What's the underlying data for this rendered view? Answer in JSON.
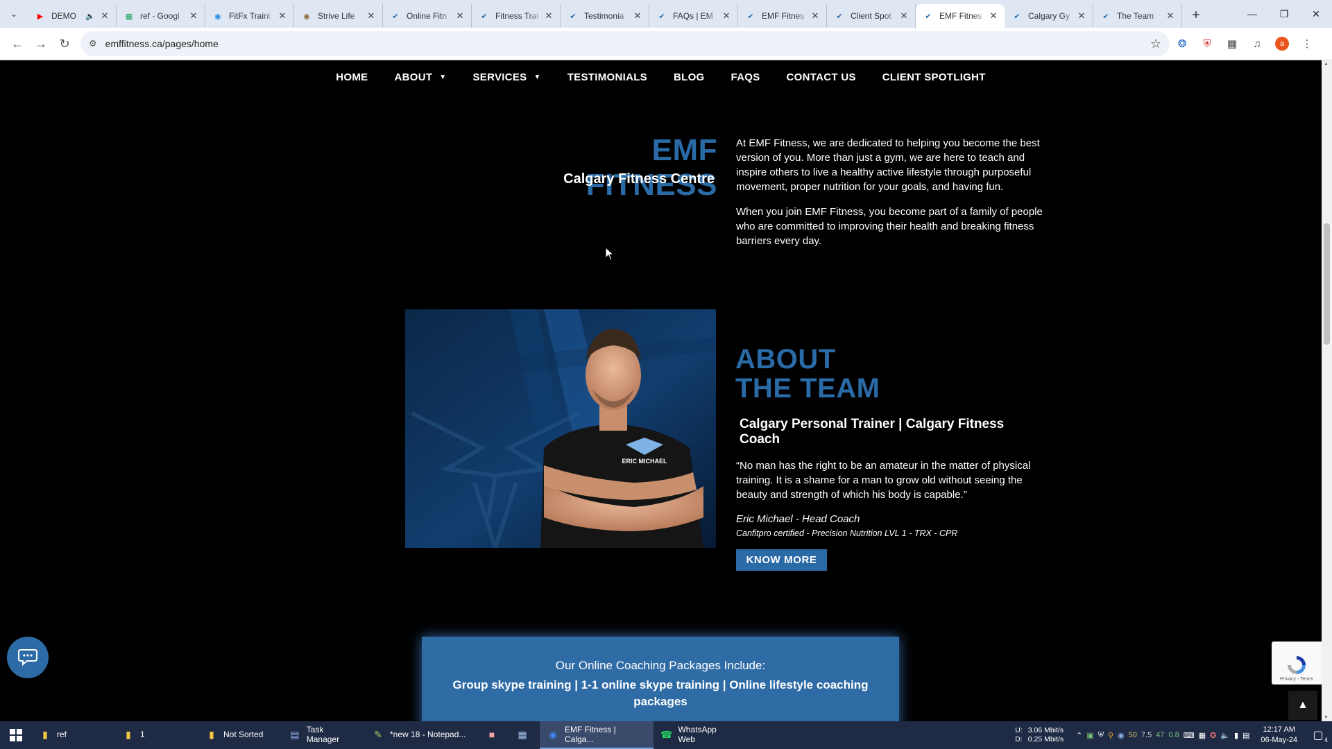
{
  "browser": {
    "tabs": [
      {
        "title": "DEMO",
        "favicon": "youtube-icon",
        "color": "#ff0000",
        "muted_icon": true
      },
      {
        "title": "ref - Googl",
        "favicon": "sheets-icon",
        "color": "#1fa463"
      },
      {
        "title": "FitFx Traini",
        "favicon": "site-icon",
        "color": "#1e88e5"
      },
      {
        "title": "Strive Life",
        "favicon": "site-icon",
        "color": "#8a6d3b"
      },
      {
        "title": "Online Fitn",
        "favicon": "emf-icon",
        "color": "#2a6aa6"
      },
      {
        "title": "Fitness Trai",
        "favicon": "emf-icon",
        "color": "#2a6aa6"
      },
      {
        "title": "Testimonia",
        "favicon": "emf-icon",
        "color": "#2a6aa6"
      },
      {
        "title": "FAQs | EM",
        "favicon": "emf-icon",
        "color": "#2a6aa6"
      },
      {
        "title": "EMF Fitnes",
        "favicon": "emf-icon",
        "color": "#2a6aa6"
      },
      {
        "title": "Client Spot",
        "favicon": "emf-icon",
        "color": "#2a6aa6"
      },
      {
        "title": "EMF Fitnes",
        "favicon": "emf-icon",
        "color": "#2a6aa6",
        "active": true
      },
      {
        "title": "Calgary Gy",
        "favicon": "emf-icon",
        "color": "#2a6aa6"
      },
      {
        "title": "The Team",
        "favicon": "emf-icon",
        "color": "#2a6aa6"
      }
    ],
    "url": "emffitness.ca/pages/home",
    "profile_initial": "a"
  },
  "site": {
    "nav": [
      {
        "label": "HOME",
        "dropdown": false
      },
      {
        "label": "ABOUT",
        "dropdown": true
      },
      {
        "label": "SERVICES",
        "dropdown": true
      },
      {
        "label": "TESTIMONIALS",
        "dropdown": false
      },
      {
        "label": "BLOG",
        "dropdown": false
      },
      {
        "label": "FAQS",
        "dropdown": false
      },
      {
        "label": "CONTACT US",
        "dropdown": false
      },
      {
        "label": "CLIENT SPOTLIGHT",
        "dropdown": false
      }
    ],
    "hero": {
      "title": "EMF FITNESS",
      "subtitle": "Calgary Fitness Centre",
      "para1": "At EMF Fitness, we are dedicated to helping you become the best version of you. More than just a gym, we are here to teach and inspire others to live a healthy active lifestyle through purposeful movement, proper nutrition for your goals, and having fun.",
      "para2": "When you join EMF Fitness, you become part of a family of people who are committed to improving their health and breaking fitness barriers every day."
    },
    "about": {
      "title_line1": "ABOUT",
      "title_line2": "THE TEAM",
      "subtitle": "Calgary Personal Trainer | Calgary Fitness Coach",
      "quote": "“No man has the right to be an amateur in the matter of physical training. It is a shame for a man to grow old without seeing the beauty and strength of which his body is capable.”",
      "coach": "Eric Michael - Head Coach",
      "certs": "Canfitpro certified - Precision Nutrition LVL 1 - TRX - CPR",
      "button": "KNOW MORE",
      "shirt_logo": "ERIC MICHAEL"
    },
    "packages": {
      "label": "Our Online Coaching Packages Include:",
      "list": "Group skype training | 1-1 online skype training | Online lifestyle coaching packages"
    },
    "recaptcha_terms": "Privacy - Terms",
    "accent_color": "#2a6aa6"
  },
  "taskbar": {
    "items": [
      {
        "label": "ref",
        "icon": "folder-icon",
        "color": "#f3c744"
      },
      {
        "label": "1",
        "icon": "folder-icon",
        "color": "#f3c744"
      },
      {
        "label": "Not Sorted",
        "icon": "folder-icon",
        "color": "#f3c744"
      },
      {
        "label": "Task Manager",
        "icon": "task-manager-icon",
        "color": "#8fb4e8"
      },
      {
        "label": "*new 18 - Notepad...",
        "icon": "notepad-plus-icon",
        "color": "#9ccc65"
      },
      {
        "label": "",
        "icon": "app-icon",
        "color": "#f0a3a3"
      },
      {
        "label": "",
        "icon": "document-icon",
        "color": "#9fc3f0"
      },
      {
        "label": "EMF Fitness | Calga...",
        "icon": "chrome-icon",
        "color": "#4285f4",
        "active": true
      },
      {
        "label": "WhatsApp Web",
        "icon": "whatsapp-icon",
        "color": "#25d366"
      }
    ],
    "net_up_label": "U:",
    "net_down_label": "D:",
    "net_up": "3.06 Mbit/s",
    "net_down": "0.25 Mbit/s",
    "tray_values": [
      "50",
      "7.5",
      "47",
      "0.8"
    ],
    "time": "12:17 AM",
    "date": "06-May-24",
    "notifications": "4"
  }
}
